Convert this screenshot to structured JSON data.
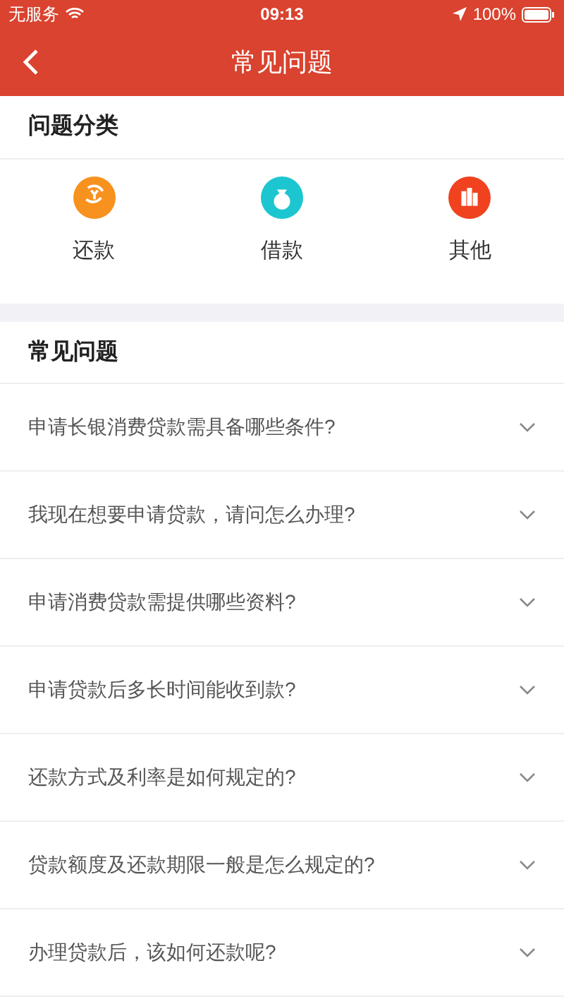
{
  "status_bar": {
    "carrier": "无服务",
    "time": "09:13",
    "battery": "100%"
  },
  "header": {
    "title": "常见问题"
  },
  "categories": {
    "title": "问题分类",
    "items": [
      {
        "label": "还款",
        "kind": "repay",
        "color": "#f7921e"
      },
      {
        "label": "借款",
        "kind": "borrow",
        "color": "#1cc6d0"
      },
      {
        "label": "其他",
        "kind": "other",
        "color": "#f0421f"
      }
    ]
  },
  "faq": {
    "title": "常见问题",
    "items": [
      {
        "question": "申请长银消费贷款需具备哪些条件?",
        "expanded": false
      },
      {
        "question": "我现在想要申请贷款，请问怎么办理?",
        "expanded": false
      },
      {
        "question": "申请消费贷款需提供哪些资料?",
        "expanded": false
      },
      {
        "question": "申请贷款后多长时间能收到款?",
        "expanded": false
      },
      {
        "question": "还款方式及利率是如何规定的?",
        "expanded": false
      },
      {
        "question": "贷款额度及还款期限一般是怎么规定的?",
        "expanded": false
      },
      {
        "question": "办理贷款后，该如何还款呢?",
        "expanded": false
      }
    ]
  }
}
